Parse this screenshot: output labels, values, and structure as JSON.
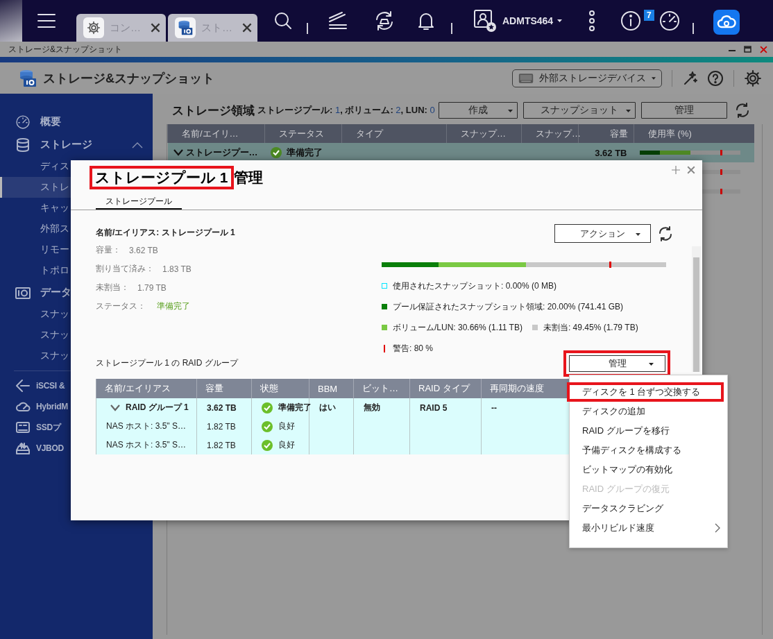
{
  "top_bar": {
    "tabs": [
      {
        "label": "コン…",
        "kind": "settings"
      },
      {
        "label": "スト…",
        "kind": "storage"
      }
    ],
    "user": "ADMTS464",
    "notification_count": "7"
  },
  "window": {
    "title": "ストレージ&スナップショット"
  },
  "app_header": {
    "title": "ストレージ&スナップショット",
    "device_menu": "外部ストレージデバイス"
  },
  "sidebar": {
    "sections": [
      {
        "label": "概要"
      },
      {
        "label": "ストレージ",
        "expanded": true,
        "children": [
          {
            "label": "ディス",
            "selected": false
          },
          {
            "label": "ストレ",
            "selected": true
          },
          {
            "label": "キャッ",
            "selected": false
          },
          {
            "label": "外部ス",
            "selected": false
          },
          {
            "label": "リモー",
            "selected": false
          },
          {
            "label": "トポロ",
            "selected": false
          }
        ]
      },
      {
        "label": "データ",
        "children": [
          {
            "label": "スナッ",
            "selected": false
          },
          {
            "label": "スナッ",
            "selected": false
          },
          {
            "label": "スナッ",
            "selected": false
          }
        ]
      }
    ],
    "bottom_items": [
      {
        "label": "iSCSI &"
      },
      {
        "label": "HybridM"
      },
      {
        "label": "SSDプ"
      },
      {
        "label": "VJBOD"
      }
    ]
  },
  "storage_area": {
    "title": "ストレージ領域",
    "summary": [
      {
        "text": "ストレージプール: ",
        "kind": "label"
      },
      {
        "text": "1",
        "kind": "count"
      },
      {
        "text": ", ボリューム: ",
        "kind": "label"
      },
      {
        "text": "2",
        "kind": "count"
      },
      {
        "text": ", LUN: ",
        "kind": "label"
      },
      {
        "text": "0",
        "kind": "count"
      }
    ],
    "buttons": [
      {
        "label": "作成",
        "dropdown": true
      },
      {
        "label": "スナップショット",
        "dropdown": true
      },
      {
        "label": "管理",
        "dropdown": false
      }
    ],
    "table": {
      "columns": [
        "名前/エイリ…",
        "ステータス",
        "タイプ",
        "スナップ…",
        "スナップ…",
        "容量",
        "使用率 (%)"
      ],
      "rows": [
        {
          "name": "ストレージプー…",
          "status": "準備完了",
          "capacity": "3.62 TB",
          "expanded": true,
          "selected": true,
          "usage": {
            "segments": [
              {
                "kind": "snapshot",
                "level": 0.2
              },
              {
                "kind": "volume",
                "level": 0.3066
              }
            ],
            "marker": {
              "level": 0.8
            }
          }
        },
        {
          "selected": false,
          "usage": {
            "marker": {
              "level": 0.8
            }
          }
        },
        {
          "selected": false,
          "usage": {
            "marker": {
              "level": 0.8
            }
          }
        }
      ]
    }
  },
  "dialog": {
    "title": "ストレージプール 1",
    "title_highlighted": true,
    "title_suffix": "管理",
    "tabs": [
      {
        "label": "ストレージプール",
        "selected": true
      }
    ],
    "name_line": "名前/エイリアス: ストレージプール 1",
    "fields": [
      {
        "label": "容量：",
        "value": "3.62 TB",
        "kind": "plain"
      },
      {
        "label": "割り当て済み：",
        "value": "1.83 TB",
        "kind": "plain"
      },
      {
        "label": "未割当：",
        "value": "1.79 TB",
        "kind": "plain"
      },
      {
        "label": "ステータス：",
        "value": "準備完了",
        "kind": "status"
      }
    ],
    "action_button": "アクション",
    "usage": {
      "segments": [
        {
          "level": 0.2,
          "color": "#0a7f0a"
        },
        {
          "level": 0.3066,
          "color": "#7ac943"
        }
      ],
      "marker": {
        "level": 0.8
      }
    },
    "legend_rows": [
      {
        "items": [
          {
            "label": "使用されたスナップショット: 0.00% (0 MB)",
            "kind": "outline",
            "color": "#00e5ff"
          }
        ]
      },
      {
        "items": [
          {
            "label": "プール保証されたスナップショット領域: 20.00% (741.41 GB)",
            "kind": "square",
            "color": "#0a7f0a"
          }
        ]
      },
      {
        "items": [
          {
            "label": "ボリューム/LUN: 30.66% (1.11 TB)",
            "kind": "square",
            "color": "#7ac943"
          },
          {
            "label": "未割当: 49.45% (1.79 TB)",
            "kind": "square",
            "color": "#c8c8c8"
          }
        ]
      },
      {
        "items": [
          {
            "label": "警告: 80 %",
            "kind": "line",
            "color": "#e00000"
          }
        ]
      }
    ],
    "raid_label": "ストレージプール 1 の RAID グループ",
    "manage_button": {
      "label": "管理",
      "highlighted": true
    },
    "raid_table": {
      "columns": [
        "名前/エイリアス",
        "容量",
        "状態",
        "BBM",
        "ビット…",
        "RAID タイプ",
        "再同期の速度"
      ],
      "rows": [
        {
          "kind": "group",
          "expanded": true,
          "name": "RAID グループ 1",
          "capacity": "3.62 TB",
          "status": "準備完了",
          "bbm": "はい",
          "bitmap": "無効",
          "raid_type": "RAID 5",
          "resync": "--"
        },
        {
          "kind": "disk",
          "name": "NAS ホスト: 3.5\" S…",
          "capacity": "1.82 TB",
          "status": "良好"
        },
        {
          "kind": "disk",
          "name": "NAS ホスト: 3.5\" S…",
          "capacity": "1.82 TB",
          "status": "良好"
        }
      ]
    }
  },
  "menu": {
    "items": [
      {
        "label": "ディスクを 1 台ずつ交換する",
        "highlighted": true,
        "disabled": false
      },
      {
        "label": "ディスクの追加",
        "highlighted": false,
        "disabled": false
      },
      {
        "label": "RAID グループを移行",
        "highlighted": false,
        "disabled": false
      },
      {
        "label": "予備ディスクを構成する",
        "highlighted": false,
        "disabled": false
      },
      {
        "label": "ビットマップの有効化",
        "highlighted": false,
        "disabled": false
      },
      {
        "label": "RAID グループの復元",
        "highlighted": false,
        "disabled": true
      },
      {
        "label": "データスクラビング",
        "highlighted": false,
        "disabled": false
      },
      {
        "label": "最小リビルド速度",
        "highlighted": false,
        "disabled": false,
        "submenu": true
      }
    ]
  }
}
